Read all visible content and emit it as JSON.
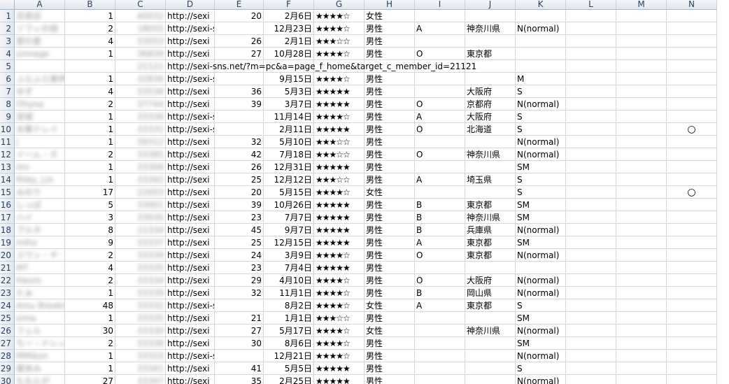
{
  "columns": [
    "A",
    "B",
    "C",
    "D",
    "E",
    "F",
    "G",
    "H",
    "I",
    "J",
    "K",
    "L",
    "M",
    "N"
  ],
  "rows": [
    {
      "n": "1",
      "a": "百貨店",
      "b": "1",
      "c": "40032",
      "d": "http://sexi",
      "e": "20",
      "f": "2月6日",
      "g": "★★★★☆",
      "h": "女性",
      "i": "",
      "j": "",
      "k": "",
      "n_mark": ""
    },
    {
      "n": "2",
      "a": "ソフィの宿",
      "b": "2",
      "c": "18055",
      "d": "http://sexi-sns.net/?m",
      "e": "",
      "f": "12月23日",
      "g": "★★★★☆",
      "h": "男性",
      "i": "A",
      "j": "神奈川県",
      "k": "N(normal)",
      "n_mark": ""
    },
    {
      "n": "3",
      "a": "愛の愛",
      "b": "4",
      "c": "33053",
      "d": "http://sexi",
      "e": "26",
      "f": "2月1日",
      "g": "★★★☆☆",
      "h": "男性",
      "i": "",
      "j": "",
      "k": "",
      "n_mark": ""
    },
    {
      "n": "4",
      "a": "sinnage",
      "b": "1",
      "c": "36839",
      "d": "http://sexi",
      "e": "27",
      "f": "10月28日",
      "g": "★★★★☆",
      "h": "男性",
      "i": "O",
      "j": "東京都",
      "k": "",
      "n_mark": ""
    },
    {
      "n": "5",
      "a": "",
      "b": "",
      "c": "21121",
      "d": "http://sexi-sns.net/?m=pc&a=page_f_home&target_c_member_id=21121",
      "e": "",
      "f": "",
      "g": "",
      "h": "",
      "i": "",
      "j": "",
      "k": "",
      "n_mark": ""
    },
    {
      "n": "6",
      "a": "ふらふら東伊",
      "b": "1",
      "c": "32836",
      "d": "http://sexi-sns.net/?m",
      "e": "",
      "f": "9月15日",
      "g": "★★★★☆",
      "h": "男性",
      "i": "",
      "j": "",
      "k": "M",
      "n_mark": ""
    },
    {
      "n": "7",
      "a": "ゆず",
      "b": "4",
      "c": "33536",
      "d": "http://sexi",
      "e": "36",
      "f": "5月3日",
      "g": "★★★★★",
      "h": "男性",
      "i": "",
      "j": "大阪府",
      "k": "S",
      "n_mark": ""
    },
    {
      "n": "8",
      "a": "Ohyna",
      "b": "2",
      "c": "37744",
      "d": "http://sexi",
      "e": "39",
      "f": "3月7日",
      "g": "★★★★★",
      "h": "男性",
      "i": "O",
      "j": "京都府",
      "k": "N(normal)",
      "n_mark": ""
    },
    {
      "n": "9",
      "a": "宮城",
      "b": "1",
      "c": "33338",
      "d": "http://sexi-sns.net/?m",
      "e": "",
      "f": "11月14日",
      "g": "★★★★☆",
      "h": "男性",
      "i": "A",
      "j": "大阪府",
      "k": "S",
      "n_mark": ""
    },
    {
      "n": "10",
      "a": "水華ドレイ",
      "b": "1",
      "c": "33331",
      "d": "http://sexi-sns.net/?m",
      "e": "",
      "f": "2月11日",
      "g": "★★★★★",
      "h": "男性",
      "i": "O",
      "j": "北海道",
      "k": "S",
      "n_mark": "○"
    },
    {
      "n": "11",
      "a": "J",
      "b": "1",
      "c": "39312",
      "d": "http://sexi",
      "e": "32",
      "f": "5月10日",
      "g": "★★★☆☆",
      "h": "男性",
      "i": "",
      "j": "",
      "k": "N(normal)",
      "n_mark": ""
    },
    {
      "n": "12",
      "a": "イーム・ガ",
      "b": "2",
      "c": "33385",
      "d": "http://sexi",
      "e": "42",
      "f": "7月18日",
      "g": "★★★☆☆",
      "h": "男性",
      "i": "O",
      "j": "神奈川県",
      "k": "N(normal)",
      "n_mark": ""
    },
    {
      "n": "13",
      "a": "iiro",
      "b": "1",
      "c": "33308",
      "d": "http://sexi",
      "e": "26",
      "f": "12月31日",
      "g": "★★★★★",
      "h": "男性",
      "i": "",
      "j": "",
      "k": "SM",
      "n_mark": ""
    },
    {
      "n": "14",
      "a": "Riley_Lin",
      "b": "1",
      "c": "33342",
      "d": "http://sexi",
      "e": "25",
      "f": "12月12日",
      "g": "★★★☆☆",
      "h": "男性",
      "i": "A",
      "j": "埼玉県",
      "k": "S",
      "n_mark": ""
    },
    {
      "n": "15",
      "a": "みのり",
      "b": "17",
      "c": "22003",
      "d": "http://sexi",
      "e": "20",
      "f": "5月15日",
      "g": "★★★★☆",
      "h": "女性",
      "i": "",
      "j": "",
      "k": "S",
      "n_mark": "○"
    },
    {
      "n": "16",
      "a": "しっぽ",
      "b": "5",
      "c": "33001",
      "d": "http://sexi",
      "e": "39",
      "f": "10月26日",
      "g": "★★★★★",
      "h": "男性",
      "i": "B",
      "j": "東京都",
      "k": "SM",
      "n_mark": ""
    },
    {
      "n": "17",
      "a": "ハイ",
      "b": "3",
      "c": "33930",
      "d": "http://sexi",
      "e": "23",
      "f": "7月7日",
      "g": "★★★★★",
      "h": "男性",
      "i": "B",
      "j": "神奈川県",
      "k": "SM",
      "n_mark": ""
    },
    {
      "n": "18",
      "a": "ブルネ",
      "b": "8",
      "c": "11334",
      "d": "http://sexi",
      "e": "45",
      "f": "9月7日",
      "g": "★★★★★",
      "h": "男性",
      "i": "B",
      "j": "兵庫県",
      "k": "N(normal)",
      "n_mark": ""
    },
    {
      "n": "19",
      "a": "miho",
      "b": "9",
      "c": "33337",
      "d": "http://sexi",
      "e": "25",
      "f": "12月15日",
      "g": "★★★★★",
      "h": "男性",
      "i": "A",
      "j": "東京都",
      "k": "SM",
      "n_mark": ""
    },
    {
      "n": "20",
      "a": "スワン・チ",
      "b": "2",
      "c": "33339",
      "d": "http://sexi",
      "e": "24",
      "f": "3月9日",
      "g": "★★★★☆",
      "h": "男性",
      "i": "O",
      "j": "東京都",
      "k": "N(normal)",
      "n_mark": ""
    },
    {
      "n": "21",
      "a": "MT",
      "b": "4",
      "c": "33335",
      "d": "http://sexi",
      "e": "23",
      "f": "7月4日",
      "g": "★★★★★",
      "h": "男性",
      "i": "",
      "j": "",
      "k": "",
      "n_mark": ""
    },
    {
      "n": "22",
      "a": "Hauro",
      "b": "2",
      "c": "33334",
      "d": "http://sexi",
      "e": "29",
      "f": "4月10日",
      "g": "★★★★☆",
      "h": "男性",
      "i": "O",
      "j": "大阪府",
      "k": "N(normal)",
      "n_mark": ""
    },
    {
      "n": "23",
      "a": "たぁ",
      "b": "1",
      "c": "33339",
      "d": "http://sexi",
      "e": "32",
      "f": "11月1日",
      "g": "★★★★☆",
      "h": "男性",
      "i": "B",
      "j": "岡山県",
      "k": "N(normal)",
      "n_mark": ""
    },
    {
      "n": "24",
      "a": "Amu Breaks",
      "b": "48",
      "c": "33332",
      "d": "http://sexi-sns.net/?m",
      "e": "",
      "f": "8月2日",
      "g": "★★★★☆",
      "h": "女性",
      "i": "A",
      "j": "東京都",
      "k": "S",
      "n_mark": ""
    },
    {
      "n": "25",
      "a": "sima",
      "b": "1",
      "c": "33335",
      "d": "http://sexi",
      "e": "21",
      "f": "1月1日",
      "g": "★★★☆☆",
      "h": "男性",
      "i": "",
      "j": "",
      "k": "SM",
      "n_mark": ""
    },
    {
      "n": "26",
      "a": "フェル",
      "b": "30",
      "c": "33330",
      "d": "http://sexi",
      "e": "27",
      "f": "5月17日",
      "g": "★★★★☆",
      "h": "女性",
      "i": "",
      "j": "神奈川県",
      "k": "N(normal)",
      "n_mark": ""
    },
    {
      "n": "27",
      "a": "ちー・ドレッシ",
      "b": "2",
      "c": "33338",
      "d": "http://sexi",
      "e": "30",
      "f": "8月6日",
      "g": "★★★★☆",
      "h": "男性",
      "i": "",
      "j": "",
      "k": "SM",
      "n_mark": ""
    },
    {
      "n": "28",
      "a": "MMikon",
      "b": "1",
      "c": "33310",
      "d": "http://sexi-sns.net/?m",
      "e": "",
      "f": "12月21日",
      "g": "★★★★☆",
      "h": "男性",
      "i": "",
      "j": "",
      "k": "N(normal)",
      "n_mark": ""
    },
    {
      "n": "29",
      "a": "夏休み",
      "b": "1",
      "c": "33341",
      "d": "http://sexi",
      "e": "41",
      "f": "5月5日",
      "g": "★★★★★",
      "h": "男性",
      "i": "",
      "j": "",
      "k": "S",
      "n_mark": ""
    },
    {
      "n": "30",
      "a": "ももんが",
      "b": "27",
      "c": "33347",
      "d": "http://sexi",
      "e": "35",
      "f": "2月25日",
      "g": "★★★★★",
      "h": "男性",
      "i": "",
      "j": "",
      "k": "N(normal)",
      "n_mark": ""
    }
  ]
}
